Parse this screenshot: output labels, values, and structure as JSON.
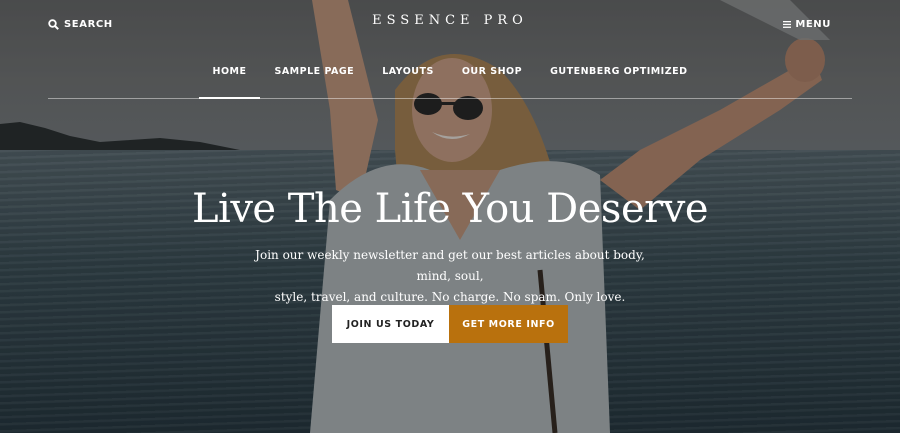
{
  "header": {
    "search_label": "SEARCH",
    "logo": "ESSENCE PRO",
    "menu_label": "MENU"
  },
  "nav": {
    "items": [
      {
        "label": "HOME",
        "active": true
      },
      {
        "label": "SAMPLE PAGE",
        "active": false
      },
      {
        "label": "LAYOUTS",
        "active": false
      },
      {
        "label": "OUR SHOP",
        "active": false
      },
      {
        "label": "GUTENBERG OPTIMIZED",
        "active": false
      }
    ]
  },
  "hero": {
    "title": "Live The Life You Deserve",
    "subtitle_line1": "Join our weekly newsletter and get our best articles about body, mind, soul,",
    "subtitle_line2": "style, travel, and culture. No charge. No spam. Only love.",
    "primary_button": "JOIN US TODAY",
    "secondary_button": "GET MORE INFO"
  },
  "colors": {
    "accent": "#b9710d",
    "text": "#ffffff"
  },
  "icons": {
    "search": "search-icon",
    "menu": "hamburger-menu-icon"
  }
}
